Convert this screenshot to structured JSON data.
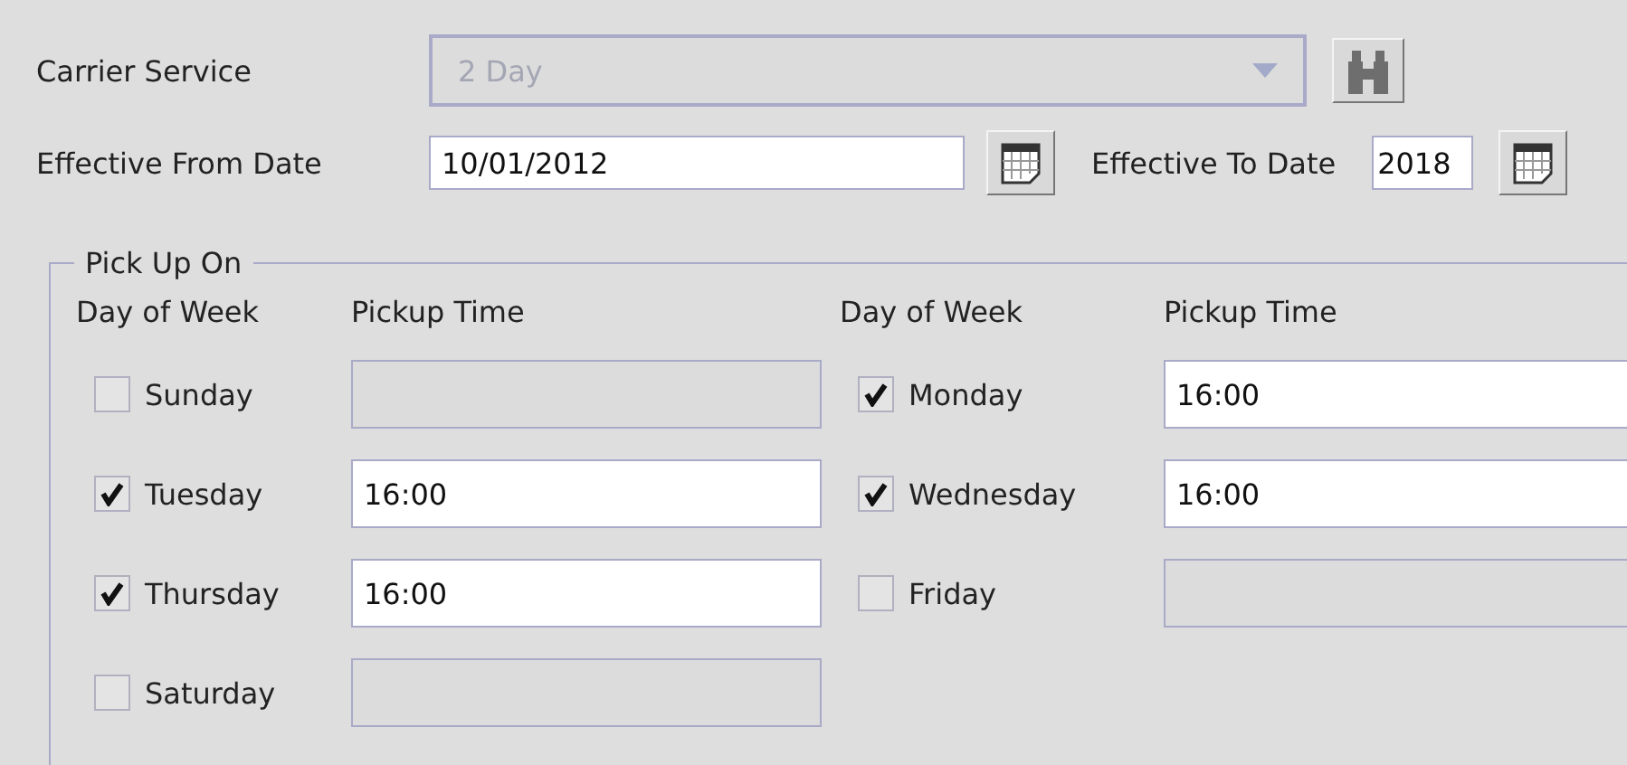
{
  "carrier_service": {
    "label": "Carrier Service",
    "value": "2 Day",
    "disabled": true
  },
  "effective_from": {
    "label": "Effective From Date",
    "value": "10/01/2012"
  },
  "effective_to": {
    "label": "Effective To Date",
    "value": "2018"
  },
  "pick_up_on": {
    "legend": "Pick Up On",
    "columns": [
      {
        "day_header": "Day of Week",
        "time_header": "Pickup Time",
        "days": [
          {
            "label": "Sunday",
            "checked": false
          },
          {
            "label": "Tuesday",
            "checked": true,
            "time": "16:00"
          },
          {
            "label": "Thursday",
            "checked": true,
            "time": "16:00"
          },
          {
            "label": "Saturday",
            "checked": false
          }
        ]
      },
      {
        "day_header": "Day of Week",
        "time_header": "Pickup Time",
        "days": [
          {
            "label": "Monday",
            "checked": true,
            "time": "16:00"
          },
          {
            "label": "Wednesday",
            "checked": true,
            "time": "16:00"
          },
          {
            "label": "Friday",
            "checked": false
          }
        ]
      }
    ]
  }
}
